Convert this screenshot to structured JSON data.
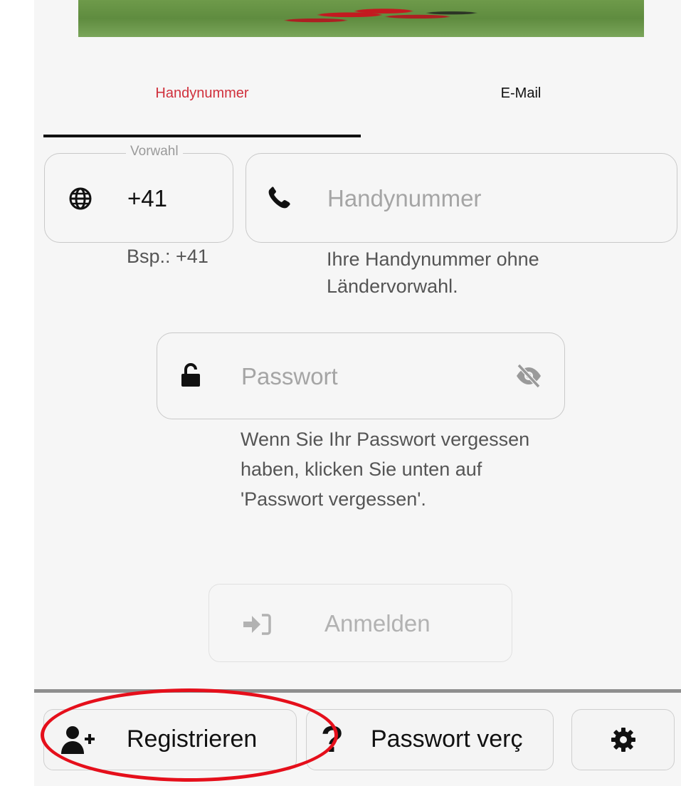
{
  "tabs": {
    "phone": "Handynummer",
    "email": "E-Mail"
  },
  "prefix": {
    "legend": "Vorwahl",
    "value": "+41",
    "hint": "Bsp.: +41"
  },
  "phone": {
    "placeholder": "Handynummer",
    "hint": "Ihre Handynummer ohne Ländervorwahl."
  },
  "password": {
    "placeholder": "Passwort",
    "hint": "Wenn Sie Ihr Passwort vergessen haben, klicken Sie unten auf 'Passwort vergessen'."
  },
  "login": {
    "label": "Anmelden",
    "enabled": false
  },
  "bottom_bar": {
    "register_label": "Registrieren",
    "forgot_label": "Passwort verç",
    "forgot_icon_glyph": "?"
  },
  "colors": {
    "active_tab": "#d0303c",
    "annotation": "#e50f1b"
  },
  "icons": {
    "prefix": "globe-icon",
    "phone": "phone-icon",
    "password": "lock-open-icon",
    "visibility": "eye-slash-icon",
    "login": "sign-in-icon",
    "register": "user-plus-icon",
    "forgot": "question-icon",
    "settings": "gear-icon"
  }
}
